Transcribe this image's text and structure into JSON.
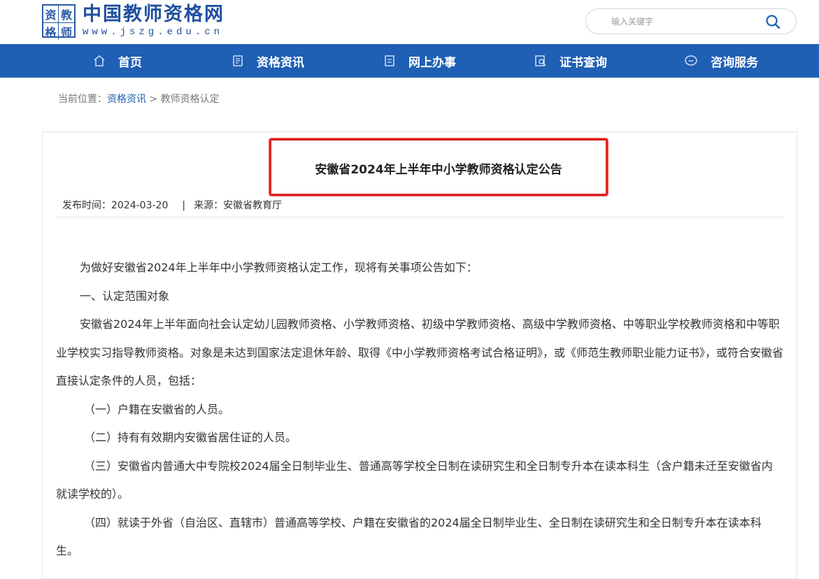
{
  "header": {
    "logo_chars": [
      "资",
      "教",
      "格",
      "师"
    ],
    "site_title": "中国教师资格网",
    "site_url": "www.jszg.edu.cn",
    "search_placeholder": "输入关键字"
  },
  "nav": {
    "items": [
      {
        "label": "首页",
        "icon": "home-icon"
      },
      {
        "label": "资格资讯",
        "icon": "news-icon"
      },
      {
        "label": "网上办事",
        "icon": "document-icon"
      },
      {
        "label": "证书查询",
        "icon": "certificate-search-icon"
      },
      {
        "label": "咨询服务",
        "icon": "chat-icon"
      }
    ]
  },
  "breadcrumb": {
    "prefix": "当前位置：",
    "link": "资格资讯",
    "separator": " > ",
    "current": "教师资格认定"
  },
  "article": {
    "title": "安徽省2024年上半年中小学教师资格认定公告",
    "publish_time": "发布时间：2024-03-20",
    "meta_separator": "|",
    "source": "来源：安徽省教育厅",
    "paragraphs": [
      "为做好安徽省2024年上半年中小学教师资格认定工作，现将有关事项公告如下：",
      "一、认定范围对象",
      "安徽省2024年上半年面向社会认定幼儿园教师资格、小学教师资格、初级中学教师资格、高级中学教师资格、中等职业学校教师资格和中等职业学校实习指导教师资格。对象是未达到国家法定退休年龄、取得《中小学教师资格考试合格证明》，或《师范生教师职业能力证书》，或符合安徽省直接认定条件的人员，包括：",
      "（一）户籍在安徽省的人员。",
      "（二）持有有效期内安徽省居住证的人员。",
      "（三）安徽省内普通大中专院校2024届全日制毕业生、普通高等学校全日制在读研究生和全日制专升本在读本科生（含户籍未迁至安徽省内就读学校的）。",
      "（四）就读于外省（自治区、直辖市）普通高等学校、户籍在安徽省的2024届全日制毕业生、全日制在读研究生和全日制专升本在读本科生。"
    ]
  },
  "colors": {
    "nav_bg": "#1f5fb4",
    "brand": "#1f4fa0",
    "highlight": "#e02020"
  }
}
